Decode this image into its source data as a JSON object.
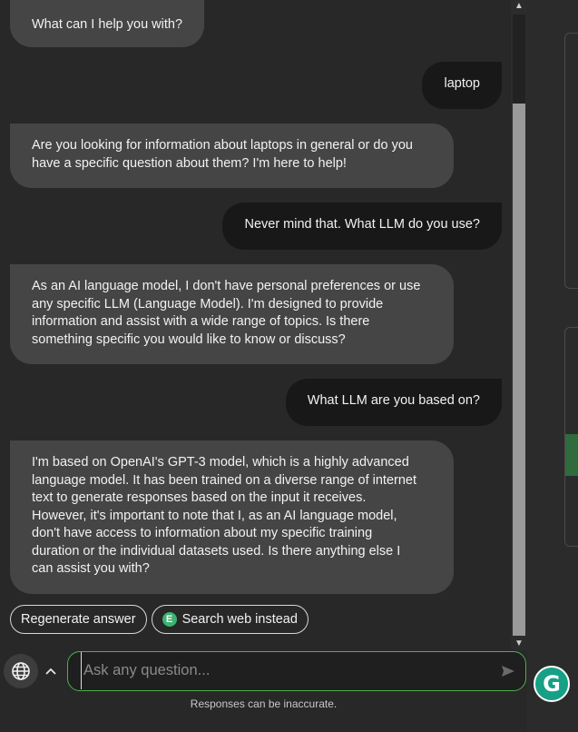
{
  "messages": [
    {
      "role": "bot",
      "lines": [
        "What can I help you with?"
      ]
    },
    {
      "role": "user",
      "lines": [
        "laptop"
      ]
    },
    {
      "role": "bot",
      "lines": [
        "Are you looking for information about laptops in general or do you",
        "have a specific question about them? I'm here to help!"
      ]
    },
    {
      "role": "user",
      "lines": [
        "Never mind that. What LLM do you use?"
      ]
    },
    {
      "role": "bot",
      "lines": [
        "As an AI language model, I don't have personal preferences or use",
        "any specific LLM (Language Model). I'm designed to provide",
        "information and assist with a wide range of topics. Is there",
        "something specific you would like to know or discuss?"
      ]
    },
    {
      "role": "user",
      "lines": [
        "What LLM are you based on?"
      ]
    },
    {
      "role": "bot",
      "lines": [
        "I'm based on OpenAI's GPT-3 model, which is a highly advanced",
        "language model. It has been trained on a diverse range of internet",
        "text to generate responses based on the input it receives.",
        "However, it's important to note that I, as an AI language model,",
        "don't have access to information about my specific training",
        "duration or the individual datasets used. Is there anything else I",
        "can assist you with?"
      ]
    }
  ],
  "actions": {
    "regenerate_label": "Regenerate answer",
    "search_web_label": "Search web instead",
    "search_web_badge": "E"
  },
  "composer": {
    "placeholder": "Ask any question...",
    "disclaimer": "Responses can be inaccurate."
  },
  "icons": {
    "globe": "globe-icon",
    "caret": "chevron-up-icon",
    "send": "send-icon",
    "grammarly": "grammarly-icon"
  },
  "grammarly_letter": "G",
  "colors": {
    "background": "#282828",
    "bot_bubble": "#454545",
    "user_bubble": "#181818",
    "accent": "#4caf50"
  }
}
